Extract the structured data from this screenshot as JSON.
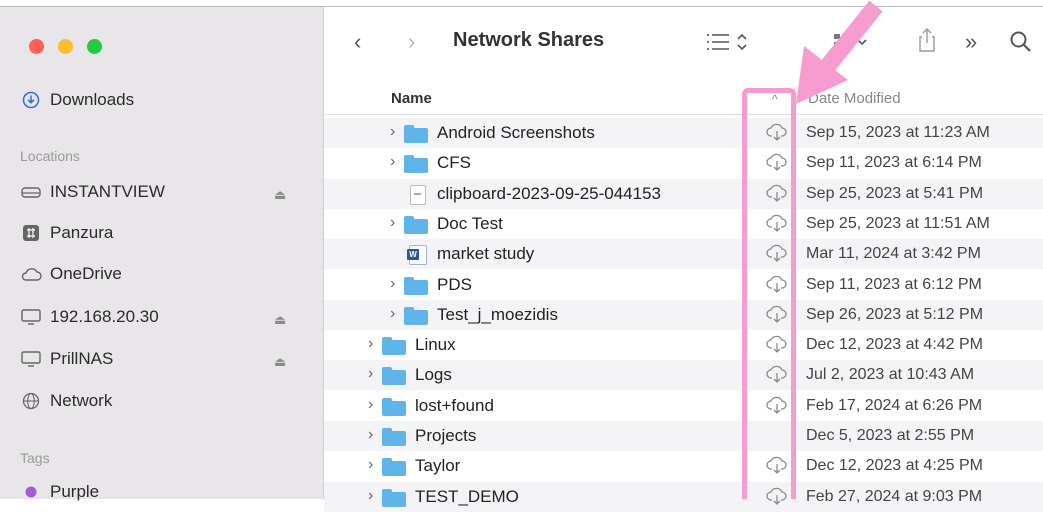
{
  "window": {
    "title": "Network Shares",
    "top_text_left": "",
    "top_text_right": ""
  },
  "toolbar": {
    "back": "‹",
    "forward": "›",
    "view_icon": "list-view-icon",
    "group_icon": "group-icon",
    "share_icon": "share-icon",
    "more": "»",
    "search_icon": "search-icon"
  },
  "sidebar": {
    "favorites": [
      {
        "label": "Downloads",
        "icon": "download-icon"
      }
    ],
    "locations_header": "Locations",
    "locations": [
      {
        "label": "INSTANTVIEW",
        "icon": "drive-icon",
        "eject": true
      },
      {
        "label": "Panzura",
        "icon": "panzura-icon",
        "eject": false
      },
      {
        "label": "OneDrive",
        "icon": "cloud-icon",
        "eject": false
      },
      {
        "label": "192.168.20.30",
        "icon": "computer-icon",
        "eject": true
      },
      {
        "label": "PrillNAS",
        "icon": "computer-icon",
        "eject": true
      },
      {
        "label": "Network",
        "icon": "network-icon",
        "eject": false
      }
    ],
    "tags_header": "Tags",
    "tags": [
      {
        "label": "Purple",
        "color": "#a05cd6"
      }
    ]
  },
  "columns": {
    "name": "Name",
    "date_modified": "Date Modified"
  },
  "rows": [
    {
      "name": "Android Screenshots",
      "kind": "folder",
      "indent": 1,
      "cloud": true,
      "date": "Sep 15, 2023 at 11:23 AM"
    },
    {
      "name": "CFS",
      "kind": "folder",
      "indent": 1,
      "cloud": true,
      "date": "Sep 11, 2023 at 6:14 PM"
    },
    {
      "name": "clipboard-2023-09-25-044153",
      "kind": "file",
      "indent": 1,
      "cloud": true,
      "date": "Sep 25, 2023 at 5:41 PM"
    },
    {
      "name": "Doc Test",
      "kind": "folder",
      "indent": 1,
      "cloud": true,
      "date": "Sep 25, 2023 at 11:51 AM"
    },
    {
      "name": "market study",
      "kind": "word",
      "indent": 1,
      "cloud": true,
      "date": "Mar 11, 2024 at 3:42 PM"
    },
    {
      "name": "PDS",
      "kind": "folder",
      "indent": 1,
      "cloud": true,
      "date": "Sep 11, 2023 at 6:12 PM"
    },
    {
      "name": "Test_j_moezidis",
      "kind": "folder",
      "indent": 1,
      "cloud": true,
      "date": "Sep 26, 2023 at 5:12 PM"
    },
    {
      "name": "Linux",
      "kind": "folder",
      "indent": 0,
      "cloud": true,
      "date": "Dec 12, 2023 at 4:42 PM"
    },
    {
      "name": "Logs",
      "kind": "folder",
      "indent": 0,
      "cloud": true,
      "date": "Jul 2, 2023 at 10:43 AM"
    },
    {
      "name": "lost+found",
      "kind": "folder",
      "indent": 0,
      "cloud": true,
      "date": "Feb 17, 2024 at 6:26 PM"
    },
    {
      "name": "Projects",
      "kind": "folder",
      "indent": 0,
      "cloud": false,
      "date": "Dec 5, 2023 at 2:55 PM"
    },
    {
      "name": "Taylor",
      "kind": "folder",
      "indent": 0,
      "cloud": true,
      "date": "Dec 12, 2023 at 4:25 PM"
    },
    {
      "name": "TEST_DEMO",
      "kind": "folder",
      "indent": 0,
      "cloud": true,
      "date": "Feb 27, 2024 at 9:03 PM"
    }
  ],
  "annotation": {
    "highlight_color": "#f79ccf",
    "arrow_color": "#f79ccf"
  }
}
